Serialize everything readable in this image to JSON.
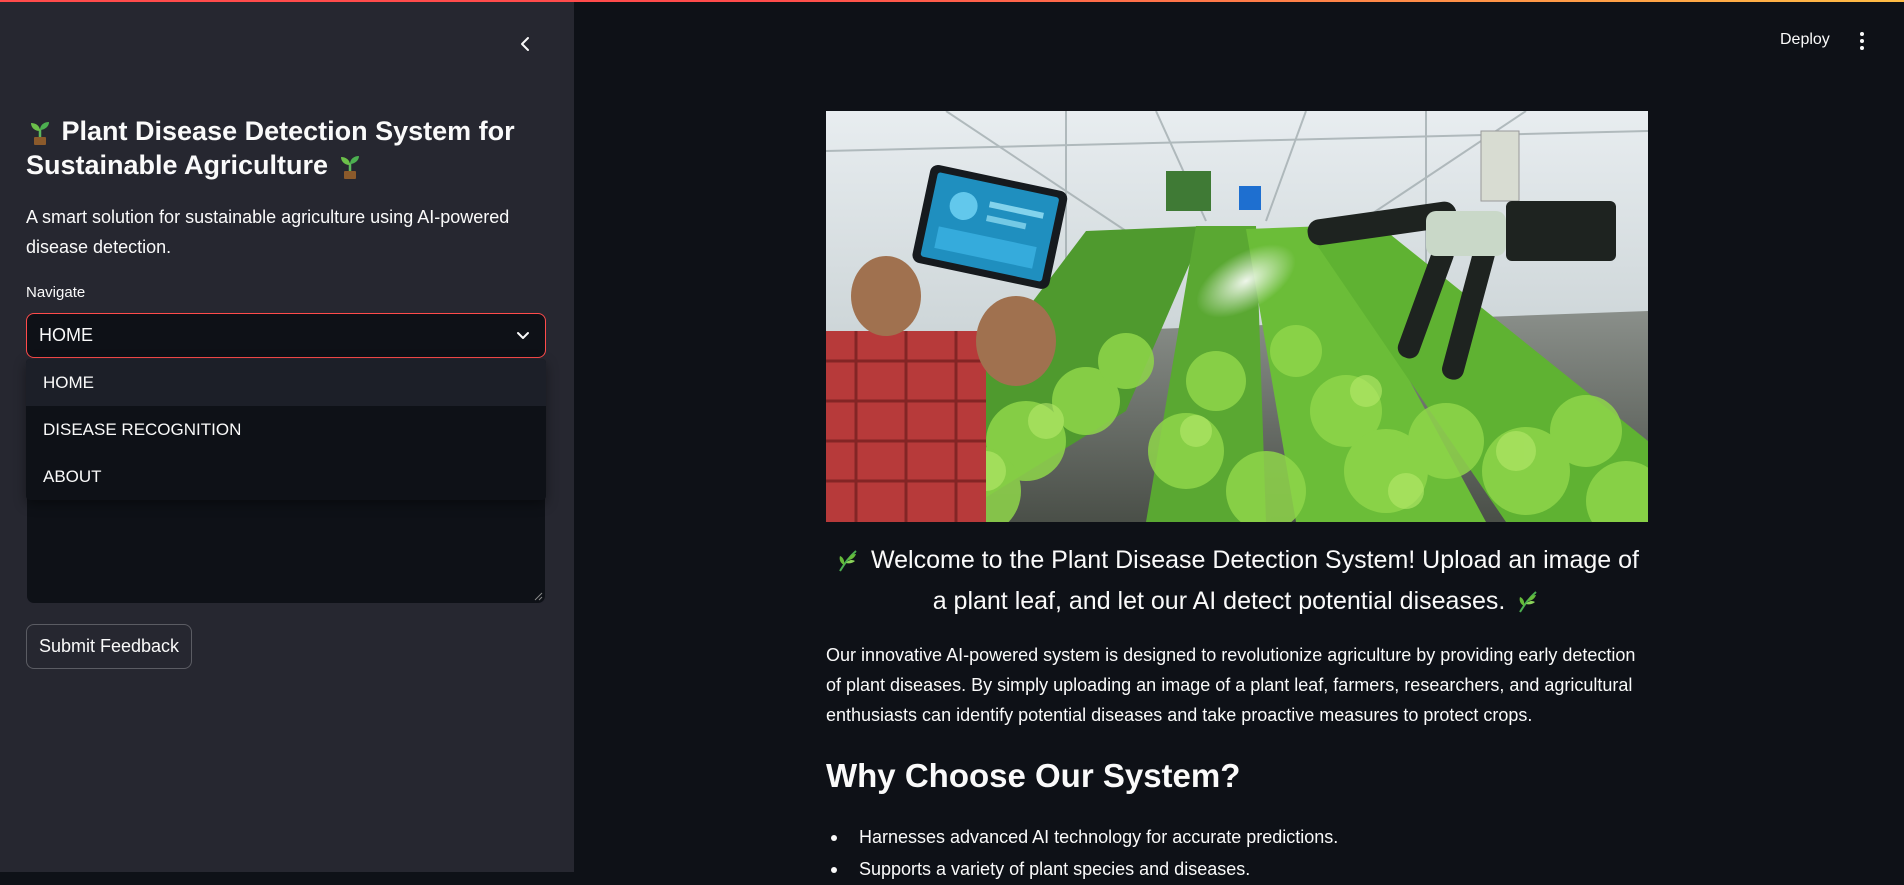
{
  "sidebar": {
    "title_line1": "Plant Disease Detection System for",
    "title_line2": "Sustainable Agriculture",
    "subtitle": "A smart solution for sustainable agriculture using AI-powered disease detection.",
    "nav_label": "Navigate",
    "selected": "HOME",
    "options": [
      "HOME",
      "DISEASE RECOGNITION",
      "ABOUT"
    ],
    "submit_label": "Submit Feedback",
    "seedling_icon": "seedling-icon"
  },
  "header": {
    "deploy_label": "Deploy",
    "menu_icon": "kebab-menu-icon"
  },
  "main": {
    "welcome": "Welcome to the Plant Disease Detection System! Upload an image of a plant leaf, and let our AI detect potential diseases.",
    "description": "Our innovative AI-powered system is designed to revolutionize agriculture by providing early detection of plant diseases. By simply uploading an image of a plant leaf, farmers, researchers, and agricultural enthusiasts can identify potential diseases and take proactive measures to protect crops.",
    "why_heading": "Why Choose Our System?",
    "bullets": [
      "Harnesses advanced AI technology for accurate predictions.",
      "Supports a variety of plant species and diseases."
    ],
    "herb_icon": "herb-icon"
  },
  "colors": {
    "accent": "#ff4b4b",
    "sidebar_bg": "#262730",
    "main_bg": "#0e1117"
  }
}
